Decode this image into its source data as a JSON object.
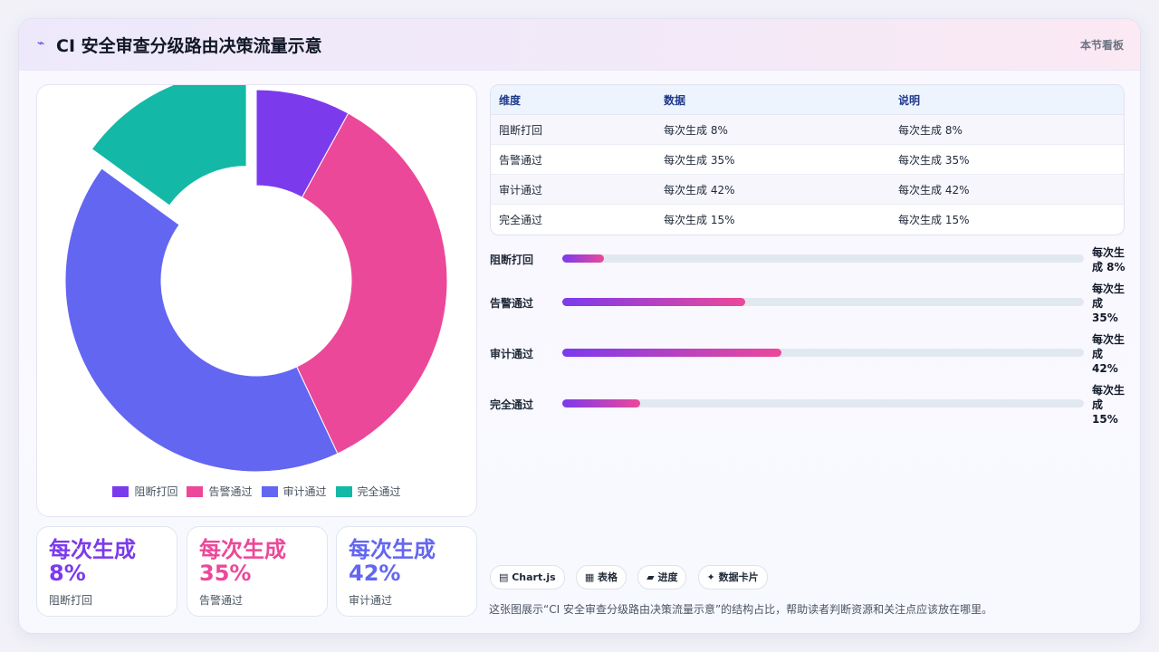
{
  "header": {
    "icon": "bolt-icon",
    "title": "CI 安全审查分级路由决策流量示意",
    "tag": "本节看板"
  },
  "chart_data": {
    "type": "pie",
    "variant": "donut",
    "categories": [
      "阻断打回",
      "告警通过",
      "审计通过",
      "完全通过"
    ],
    "values": [
      8,
      35,
      42,
      15
    ],
    "unit": "%",
    "colors": [
      "#7c3aed",
      "#ec4899",
      "#6366f1",
      "#14b8a6"
    ],
    "exploded_slice": "完全通过",
    "legend": "bottom"
  },
  "kpis": [
    {
      "value": "每次生成 8%",
      "label": "阻断打回",
      "color": "#7c3aed"
    },
    {
      "value": "每次生成 35%",
      "label": "告警通过",
      "color": "#ec4899"
    },
    {
      "value": "每次生成 42%",
      "label": "审计通过",
      "color": "#6366f1"
    }
  ],
  "table": {
    "headers": [
      "维度",
      "数据",
      "说明"
    ],
    "rows": [
      [
        "阻断打回",
        "每次生成 8%",
        "每次生成 8%"
      ],
      [
        "告警通过",
        "每次生成 35%",
        "每次生成 35%"
      ],
      [
        "审计通过",
        "每次生成 42%",
        "每次生成 42%"
      ],
      [
        "完全通过",
        "每次生成 15%",
        "每次生成 15%"
      ]
    ]
  },
  "bars": [
    {
      "label": "阻断打回",
      "value": 8,
      "text": "每次生成 8%"
    },
    {
      "label": "告警通过",
      "value": 35,
      "text": "每次生成 35%"
    },
    {
      "label": "审计通过",
      "value": 42,
      "text": "每次生成 42%"
    },
    {
      "label": "完全通过",
      "value": 15,
      "text": "每次生成 15%"
    }
  ],
  "chips": [
    "▤ Chart.js",
    "▦ 表格",
    "▰ 进度",
    "✦ 数据卡片"
  ],
  "note": "这张图展示“CI 安全审查分级路由决策流量示意”的结构占比，帮助读者判断资源和关注点应该放在哪里。"
}
